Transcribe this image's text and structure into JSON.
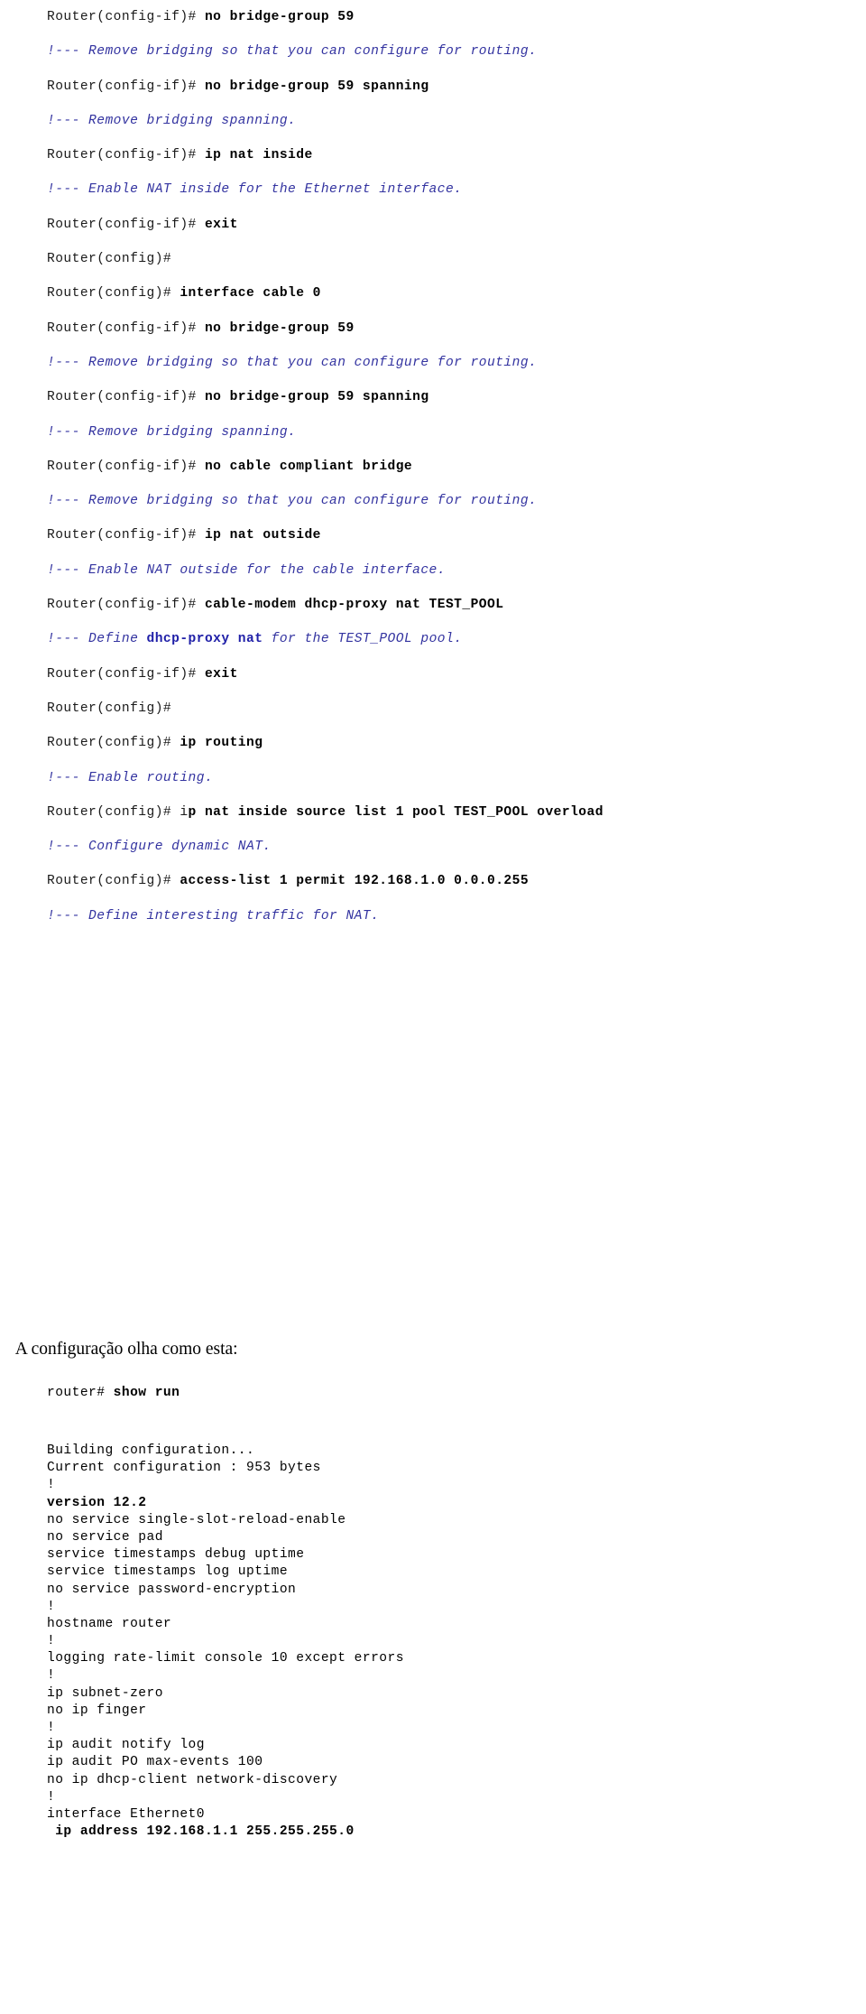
{
  "document": {
    "type": "cisco-router-configuration-transcript",
    "comment_color": "#3333a0",
    "text_color": "#000000"
  },
  "cli_transcript": [
    {
      "kind": "prompt",
      "prompt": "Router(config-if)# ",
      "command": "no bridge-group 59"
    },
    {
      "kind": "comment",
      "text": "!--- Remove bridging so that you can configure for routing."
    },
    {
      "kind": "prompt",
      "prompt": "Router(config-if)# ",
      "command": "no bridge-group 59 spanning"
    },
    {
      "kind": "comment",
      "text": "!--- Remove bridging spanning."
    },
    {
      "kind": "prompt",
      "prompt": "Router(config-if)# ",
      "command": "ip nat inside"
    },
    {
      "kind": "comment",
      "text": "!--- Enable NAT inside for the Ethernet interface."
    },
    {
      "kind": "prompt",
      "prompt": "Router(config-if)# ",
      "command": "exit"
    },
    {
      "kind": "prompt",
      "prompt": "Router(config)#",
      "command": ""
    },
    {
      "kind": "prompt",
      "prompt": "Router(config)# ",
      "command": "interface cable 0"
    },
    {
      "kind": "prompt",
      "prompt": "Router(config-if)# ",
      "command": "no bridge-group 59"
    },
    {
      "kind": "comment",
      "text": "!--- Remove bridging so that you can configure for routing."
    },
    {
      "kind": "prompt",
      "prompt": "Router(config-if)# ",
      "command": "no bridge-group 59 spanning"
    },
    {
      "kind": "comment",
      "text": "!--- Remove bridging spanning."
    },
    {
      "kind": "prompt",
      "prompt": "Router(config-if)# ",
      "command": "no cable compliant bridge"
    },
    {
      "kind": "comment",
      "text": "!--- Remove bridging so that you can configure for routing."
    },
    {
      "kind": "prompt",
      "prompt": "Router(config-if)# ",
      "command": "ip nat outside"
    },
    {
      "kind": "comment",
      "text": "!--- Enable NAT outside for the cable interface."
    },
    {
      "kind": "prompt",
      "prompt": "Router(config-if)# ",
      "command": "cable-modem dhcp-proxy nat TEST_POOL"
    },
    {
      "kind": "comment",
      "pre": "!--- Define ",
      "highlight": "dhcp-proxy nat",
      "post": " for the TEST_POOL pool."
    },
    {
      "kind": "prompt",
      "prompt": "Router(config-if)# ",
      "command": "exit"
    },
    {
      "kind": "prompt",
      "prompt": "Router(config)#",
      "command": ""
    },
    {
      "kind": "prompt",
      "prompt": "Router(config)# ",
      "command": "ip routing"
    },
    {
      "kind": "comment",
      "text": "!--- Enable routing."
    },
    {
      "kind": "prompt",
      "prompt": "Router(config)# i",
      "command": "p nat inside source list 1 pool TEST_POOL overload"
    },
    {
      "kind": "comment",
      "text": "!--- Configure dynamic NAT."
    },
    {
      "kind": "prompt",
      "prompt": "Router(config)# ",
      "command": "access-list 1 permit 192.168.1.0 0.0.0.255"
    },
    {
      "kind": "comment",
      "text": "!--- Define interesting traffic for NAT."
    }
  ],
  "narrative": {
    "heading": "A configuração olha como esta:"
  },
  "showrun": {
    "prompt": "router# ",
    "command": "show run"
  },
  "config_dump": [
    {
      "text": "Building configuration...",
      "bold": false
    },
    {
      "text": "Current configuration : 953 bytes",
      "bold": false
    },
    {
      "text": "!",
      "bold": false
    },
    {
      "text": "version 12.2",
      "bold": true
    },
    {
      "text": "no service single-slot-reload-enable",
      "bold": false
    },
    {
      "text": "no service pad",
      "bold": false
    },
    {
      "text": "service timestamps debug uptime",
      "bold": false
    },
    {
      "text": "service timestamps log uptime",
      "bold": false
    },
    {
      "text": "no service password-encryption",
      "bold": false
    },
    {
      "text": "!",
      "bold": false
    },
    {
      "text": "hostname router",
      "bold": false
    },
    {
      "text": "!",
      "bold": false
    },
    {
      "text": "logging rate-limit console 10 except errors",
      "bold": false
    },
    {
      "text": "!",
      "bold": false
    },
    {
      "text": "ip subnet-zero",
      "bold": false
    },
    {
      "text": "no ip finger",
      "bold": false
    },
    {
      "text": "!",
      "bold": false
    },
    {
      "text": "ip audit notify log",
      "bold": false
    },
    {
      "text": "ip audit PO max-events 100",
      "bold": false
    },
    {
      "text": "no ip dhcp-client network-discovery",
      "bold": false
    },
    {
      "text": "!",
      "bold": false
    },
    {
      "text": "interface Ethernet0",
      "bold": false
    },
    {
      "text": " ip address 192.168.1.1 255.255.255.0",
      "bold": true
    }
  ]
}
